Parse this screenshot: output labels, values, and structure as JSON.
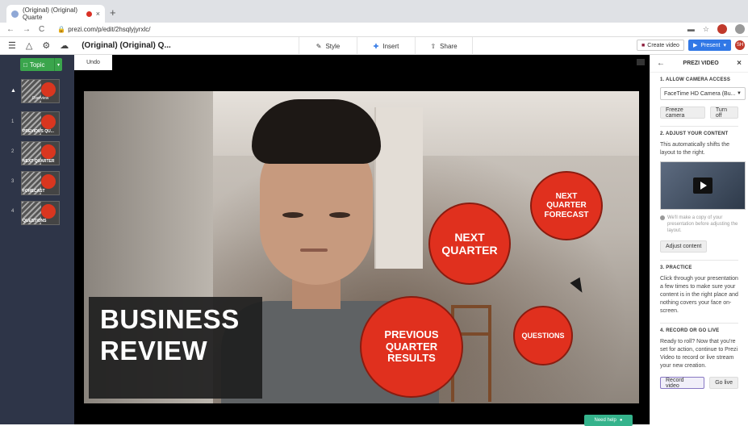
{
  "browser": {
    "tab_title": "(Original) (Original) Quarte",
    "tab_close": "×",
    "new_tab": "+",
    "url": "prezi.com/p/edit/2hsqlyjyrxlc/",
    "nav_back": "←",
    "nav_forward": "→",
    "nav_reload": "C"
  },
  "toolbar": {
    "presentation_title": "(Original) (Original) Q...",
    "style_label": "Style",
    "insert_label": "Insert",
    "share_label": "Share",
    "create_video_label": "Create video",
    "present_label": "Present",
    "avatar_initials": "SH"
  },
  "left_panel": {
    "topic_label": "Topic",
    "overview_label": "Overview",
    "topics": [
      {
        "num": "1",
        "caption": "PREVIOUS QU..."
      },
      {
        "num": "2",
        "caption": "NEXT QUARTER"
      },
      {
        "num": "3",
        "caption": "FORECAST"
      },
      {
        "num": "4",
        "caption": "QUESTIONS"
      }
    ]
  },
  "canvas": {
    "undo_label": "Undo",
    "title_line1": "BUSINESS",
    "title_line2": "REVIEW",
    "bubbles": {
      "next_quarter": [
        "NEXT",
        "QUARTER"
      ],
      "forecast": [
        "NEXT",
        "QUARTER",
        "FORECAST"
      ],
      "previous": [
        "PREVIOUS",
        "QUARTER",
        "RESULTS"
      ],
      "questions": "QUESTIONS"
    },
    "need_help_label": "Need help"
  },
  "right_panel": {
    "title": "PREZI VIDEO",
    "back": "←",
    "close": "×",
    "s1_title": "1. ALLOW CAMERA ACCESS",
    "camera_select": "FaceTime HD Camera (Bu...",
    "freeze_label": "Freeze camera",
    "turnoff_label": "Turn off",
    "s2_title": "2. ADJUST YOUR CONTENT",
    "s2_text": "This automatically shifts the layout to the right.",
    "s2_info": "We'll make a copy of your presentation before adjusting the layout.",
    "adjust_label": "Adjust content",
    "s3_title": "3. PRACTICE",
    "s3_text": "Click through your presentation a few times to make sure your content is in the right place and nothing covers your face on-screen.",
    "s4_title": "4. RECORD OR GO LIVE",
    "s4_text": "Ready to roll? Now that you're set for action, continue to Prezi Video to record or live stream your new creation.",
    "record_label": "Record video",
    "golive_label": "Go live"
  },
  "colors": {
    "accent_green": "#3aa54c",
    "present_blue": "#3178e6",
    "bubble_red": "#e0301e",
    "panel_dark": "#2e3548"
  }
}
